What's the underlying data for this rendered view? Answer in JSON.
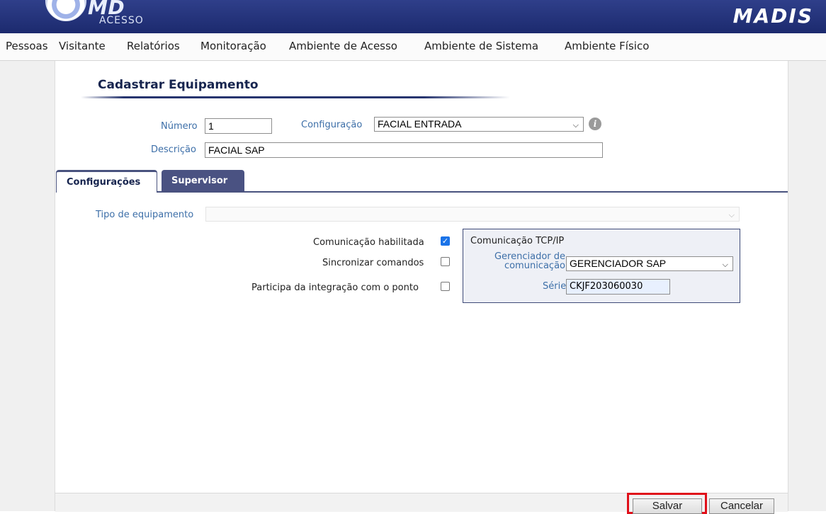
{
  "header": {
    "logo_main": "MD",
    "logo_sub": "ACESSO",
    "brand": "MADIS"
  },
  "nav": {
    "items": [
      "Pessoas",
      "Visitante",
      "Relatórios",
      "Monitoração",
      "Ambiente de Acesso",
      "Ambiente de Sistema",
      "Ambiente Físico"
    ]
  },
  "page": {
    "title": "Cadastrar Equipamento"
  },
  "form": {
    "numero_label": "Número",
    "numero_value": "1",
    "configuracao_label": "Configuração",
    "configuracao_value": "FACIAL ENTRADA",
    "descricao_label": "Descrição",
    "descricao_value": "FACIAL SAP"
  },
  "tabs": {
    "active": "Configurações",
    "inactive": "Supervisor"
  },
  "config": {
    "tipo_label": "Tipo de equipamento",
    "tipo_value": "",
    "comunicacao_label": "Comunicação habilitada",
    "comunicacao_checked": true,
    "sincronizar_label": "Sincronizar comandos",
    "sincronizar_checked": false,
    "ponto_label": "Participa da integração com o ponto",
    "ponto_checked": false
  },
  "tcp": {
    "title": "Comunicação TCP/IP",
    "gerenciador_label_1": "Gerenciador de",
    "gerenciador_label_2": "comunicação",
    "gerenciador_value": "GERENCIADOR SAP",
    "serie_label": "Série",
    "serie_value": "CKJF203060030"
  },
  "buttons": {
    "salvar": "Salvar",
    "cancelar": "Cancelar"
  },
  "colors": {
    "header": "#1c2a6e",
    "label": "#3d6fa8",
    "tab_inactive": "#4a5282",
    "highlight": "#e0101a"
  }
}
